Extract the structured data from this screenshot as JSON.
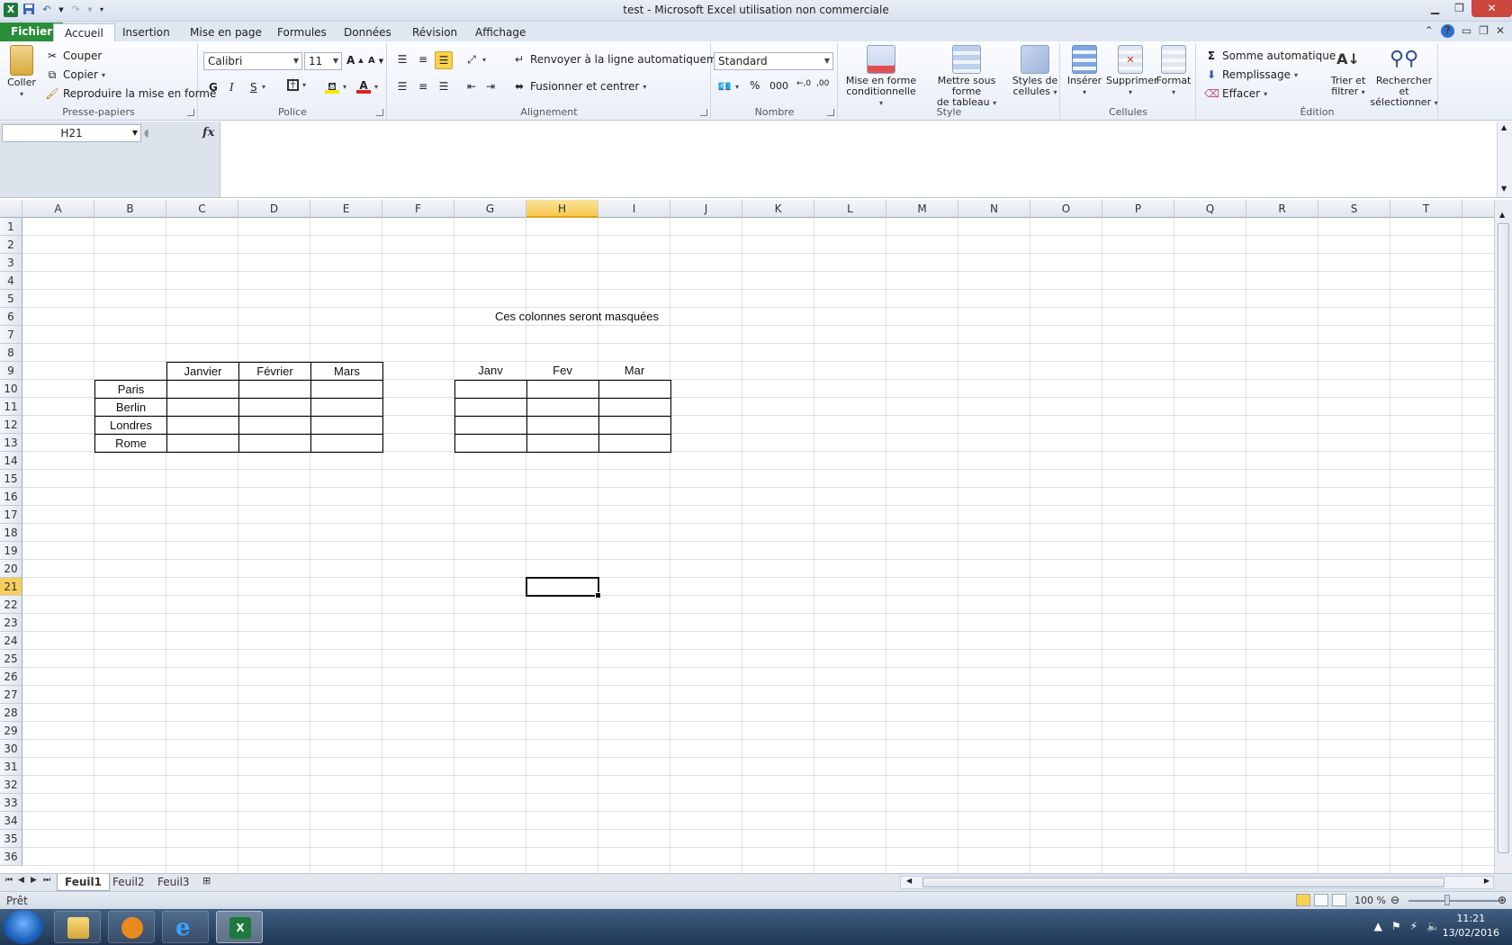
{
  "window": {
    "title": "test  -  Microsoft Excel utilisation non commerciale"
  },
  "ribbon_tabs": {
    "file": "Fichier",
    "tabs": [
      "Accueil",
      "Insertion",
      "Mise en page",
      "Formules",
      "Données",
      "Révision",
      "Affichage"
    ],
    "active": "Accueil"
  },
  "clipboard": {
    "paste": "Coller",
    "cut": "Couper",
    "copy": "Copier",
    "format_painter": "Reproduire la mise en forme",
    "label": "Presse-papiers"
  },
  "font": {
    "name": "Calibri",
    "size": "11",
    "bold": "G",
    "italic": "I",
    "underline": "S",
    "label": "Police"
  },
  "alignment": {
    "wrap": "Renvoyer à la ligne automatiquement",
    "merge": "Fusionner et centrer",
    "label": "Alignement"
  },
  "number": {
    "format": "Standard",
    "percent": "%",
    "thousands": "000",
    "label": "Nombre"
  },
  "style": {
    "conditional_line1": "Mise en forme",
    "conditional_line2": "conditionnelle",
    "table_line1": "Mettre sous forme",
    "table_line2": "de tableau",
    "cell_styles_line1": "Styles de",
    "cell_styles_line2": "cellules",
    "label": "Style"
  },
  "cells": {
    "insert": "Insérer",
    "delete": "Supprimer",
    "format": "Format",
    "label": "Cellules"
  },
  "editing": {
    "autosum": "Somme automatique",
    "fill": "Remplissage",
    "clear": "Effacer",
    "sort_line1": "Trier et",
    "sort_line2": "filtrer",
    "find_line1": "Rechercher et",
    "find_line2": "sélectionner",
    "label": "Édition"
  },
  "formula_bar": {
    "name_box": "H21",
    "fx": "fx",
    "formula": ""
  },
  "grid": {
    "columns": [
      "A",
      "B",
      "C",
      "D",
      "E",
      "F",
      "G",
      "H",
      "I",
      "J",
      "K",
      "L",
      "M",
      "N",
      "O",
      "P",
      "Q",
      "R",
      "S",
      "T"
    ],
    "rows": [
      "1",
      "2",
      "3",
      "4",
      "5",
      "6",
      "7",
      "8",
      "9",
      "10",
      "11",
      "12",
      "13",
      "14",
      "15",
      "16",
      "17",
      "18",
      "19",
      "20",
      "21",
      "22",
      "23",
      "24",
      "25",
      "26",
      "27",
      "28",
      "29",
      "30",
      "31",
      "32",
      "33",
      "34",
      "35",
      "36"
    ],
    "selected_column": "H",
    "selected_row": "21",
    "note": "Ces colonnes seront masquées",
    "table1": {
      "headers": [
        "Janvier",
        "Février",
        "Mars"
      ],
      "cities": [
        "Paris",
        "Berlin",
        "Londres",
        "Rome"
      ]
    },
    "table2": {
      "headers": [
        "Janv",
        "Fev",
        "Mar"
      ]
    }
  },
  "sheet_tabs": [
    "Feuil1",
    "Feuil2",
    "Feuil3"
  ],
  "status": {
    "text": "Prêt",
    "zoom": "100 %"
  },
  "taskbar": {
    "time": "11:21",
    "date": "13/02/2016"
  },
  "colors": {
    "file_tab": "#2a8d3a",
    "selection_header": "#f5c94f",
    "taskbar": "#1f3653"
  }
}
